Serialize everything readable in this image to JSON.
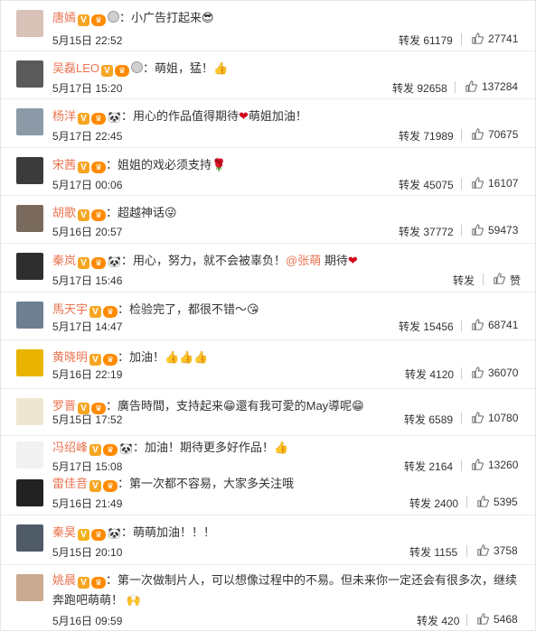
{
  "repost_label": "转发",
  "like_label": "赞",
  "comments": [
    {
      "user": "唐嫣",
      "text": "小广告打起来",
      "emoji": "😎",
      "date": "5月15日 22:52",
      "reposts": "61179",
      "likes": "27741",
      "avatar_color": "#d9c2b8"
    },
    {
      "user": "吴磊LEO",
      "text": "萌姐，猛！",
      "emoji": "👍",
      "date": "5月17日 15:20",
      "reposts": "92658",
      "likes": "137284",
      "avatar_color": "#5a5a5a"
    },
    {
      "user": "杨洋",
      "text": "用心的作品值得期待",
      "emoji": "❤",
      "text2": "萌姐加油！",
      "date": "5月17日 22:45",
      "reposts": "71989",
      "likes": "70675",
      "avatar_color": "#8c9aa8"
    },
    {
      "user": "宋茜",
      "text": "姐姐的戏必须支持",
      "emoji": "🌹",
      "date": "5月17日 00:06",
      "reposts": "45075",
      "likes": "16107",
      "avatar_color": "#3b3b3b"
    },
    {
      "user": "胡歌",
      "text": "超越神话",
      "emoji": "😜",
      "date": "5月16日 20:57",
      "reposts": "37772",
      "likes": "59473",
      "avatar_color": "#7a6a5e"
    },
    {
      "user": "秦岚",
      "text": "用心，努力，就不会被辜负！",
      "mention": "@张萌",
      "text2": " 期待",
      "emoji": "❤",
      "date": "5月17日 15:46",
      "reposts": "转发",
      "likes": "赞",
      "avatar_color": "#2e2e2e"
    },
    {
      "user": "馬天宇",
      "text": "检验完了，都很不错～",
      "emoji": "😘",
      "date": "5月17日 14:47",
      "reposts": "15456",
      "likes": "68741",
      "avatar_color": "#6e7f91"
    },
    {
      "user": "黄晓明",
      "text": "加油！",
      "emoji": "👍👍👍",
      "date": "5月16日 22:19",
      "reposts": "4120",
      "likes": "36070",
      "avatar_color": "#e8b400"
    },
    {
      "user": "罗晋",
      "text": "廣告時間，支持起来",
      "emoji": "😁",
      "text2": "還有我可愛的May導呢",
      "emoji2": "😁",
      "date": "5月15日 17:52",
      "reposts": "6589",
      "likes": "10780",
      "avatar_color": "#efe6d2"
    },
    {
      "user": "冯绍峰",
      "text": "加油！期待更多好作品！",
      "emoji": "👍",
      "date": "5月17日 15:08",
      "reposts": "2164",
      "likes": "13260",
      "avatar_color": "#f1f1f1"
    },
    {
      "user": "雷佳音",
      "text": "第一次都不容易，大家多关注哦",
      "emoji": "",
      "date": "5月16日 21:49",
      "reposts": "2400",
      "likes": "5395",
      "avatar_color": "#222222"
    },
    {
      "user": "秦昊",
      "text": "萌萌加油！！！",
      "emoji": "",
      "date": "5月15日 20:10",
      "reposts": "1155",
      "likes": "3758",
      "avatar_color": "#4f5b66"
    },
    {
      "user": "姚晨",
      "text": "第一次做制片人，可以想像过程中的不易。但未来你一定还会有很多次，继续奔跑吧萌萌！",
      "emoji": "🙌",
      "date": "5月16日 09:59",
      "reposts": "420",
      "likes": "5468",
      "avatar_color": "#c9a98f"
    }
  ]
}
